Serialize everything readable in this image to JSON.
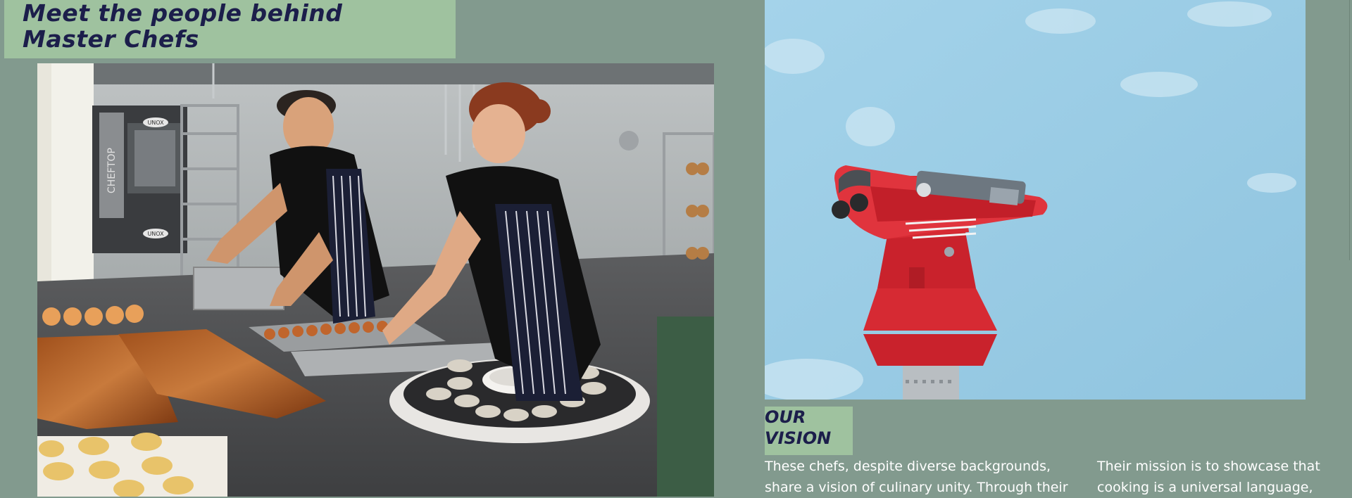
{
  "header": {
    "title_line1": "Meet the people behind",
    "title_line2": "Master Chefs"
  },
  "kitchen_photo": {
    "oven_brand": "UNOX",
    "oven_side_label": "CHEFTOP"
  },
  "vision": {
    "heading_line1": "OUR",
    "heading_line2": "VISION",
    "paragraph_1": "These chefs, despite diverse backgrounds, share a vision of culinary unity. Through their",
    "paragraph_2": "Their mission is to showcase that cooking is a universal language,"
  },
  "colors": {
    "page_background": "#829a8e",
    "title_box": "#9fc29f",
    "heading_text": "#1c1e4b",
    "body_text": "#ffffff",
    "sky": "#9ccbe2",
    "viewer_red": "#d62a33"
  }
}
